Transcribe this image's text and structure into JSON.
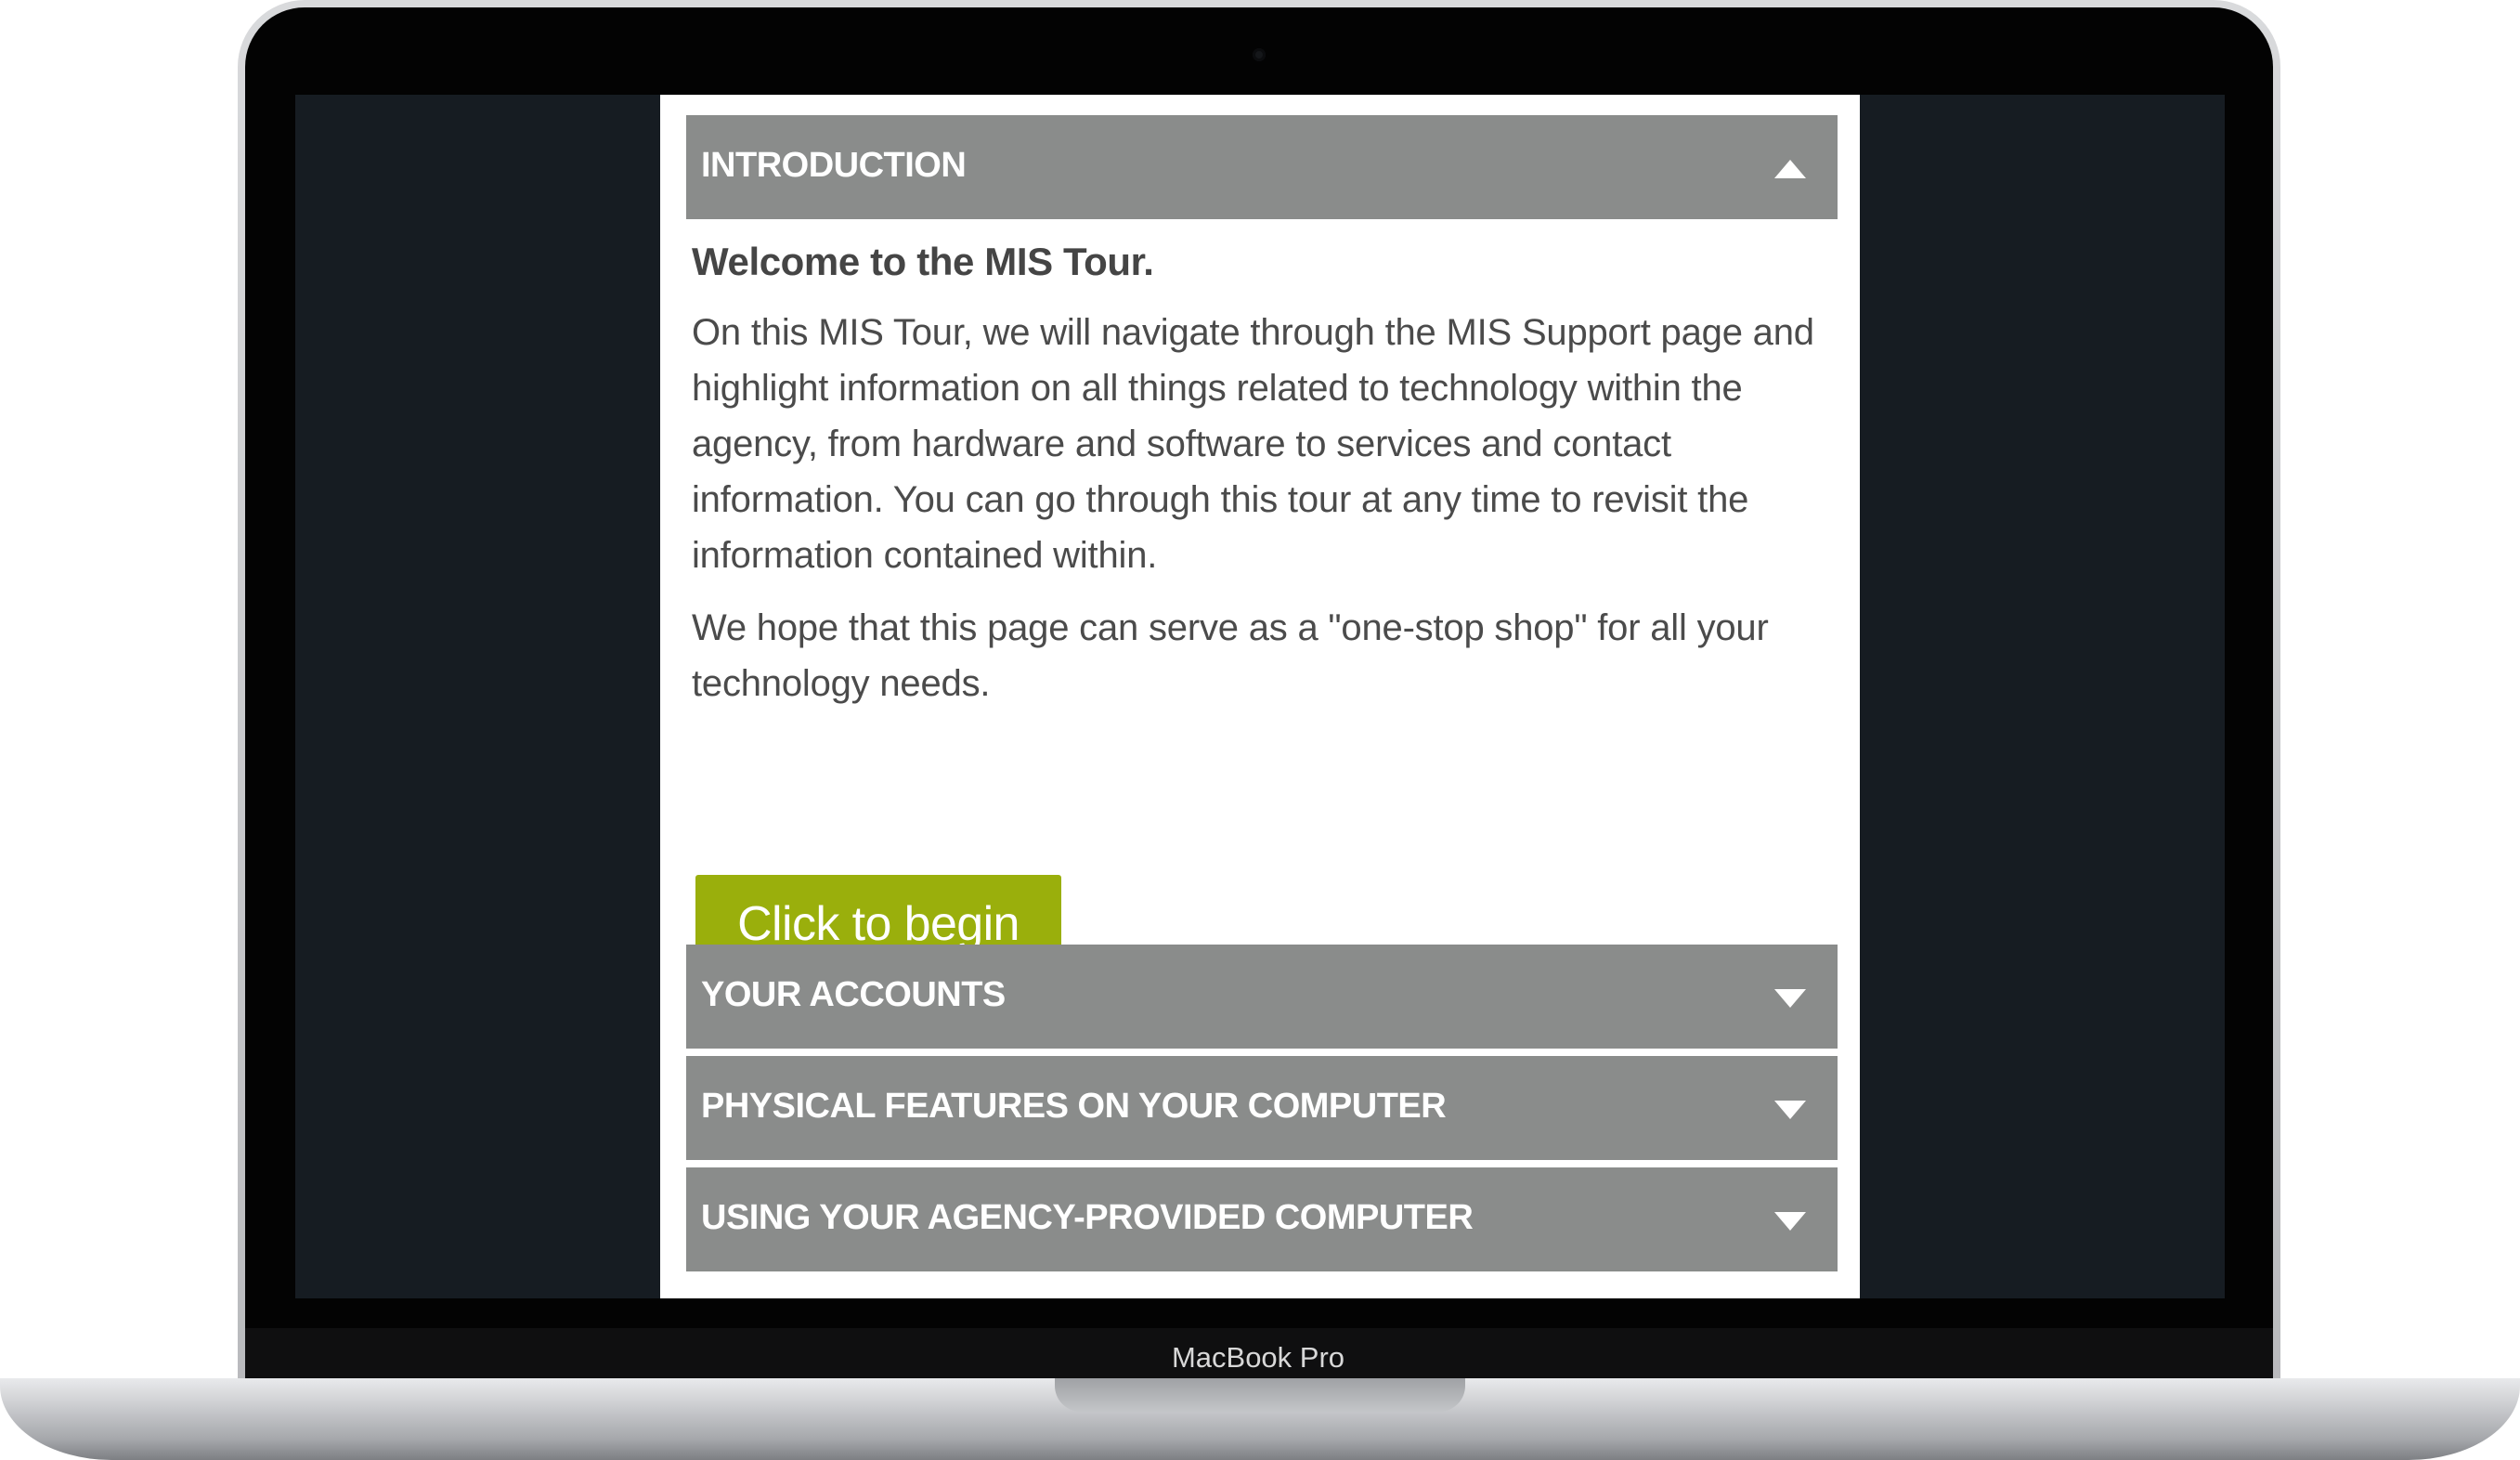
{
  "device": {
    "model_label": "MacBook Pro"
  },
  "tour": {
    "sections": [
      {
        "title": "INTRODUCTION",
        "expanded": true
      },
      {
        "title": "YOUR ACCOUNTS",
        "expanded": false
      },
      {
        "title": "PHYSICAL FEATURES ON YOUR COMPUTER",
        "expanded": false
      },
      {
        "title": "USING YOUR AGENCY-PROVIDED COMPUTER",
        "expanded": false
      }
    ],
    "intro": {
      "welcome": "Welcome to the MIS Tour.",
      "paragraph_1": "On this MIS Tour, we will navigate through the MIS Support page and highlight information on all things related to technology within the agency, from hardware and software to services and contact information. You can go through this tour at any time to revisit the information contained within.",
      "paragraph_2": "We hope that this page can serve as a \"one-stop shop\" for all your technology needs.",
      "begin_button": "Click to begin"
    }
  },
  "colors": {
    "header_bg": "#8a8c8b",
    "button_bg": "#9aaf0c",
    "screen_bg": "#161c22",
    "text": "#4b4b4b"
  },
  "icons": {
    "expanded": "caret-up-icon",
    "collapsed": "caret-down-icon"
  }
}
